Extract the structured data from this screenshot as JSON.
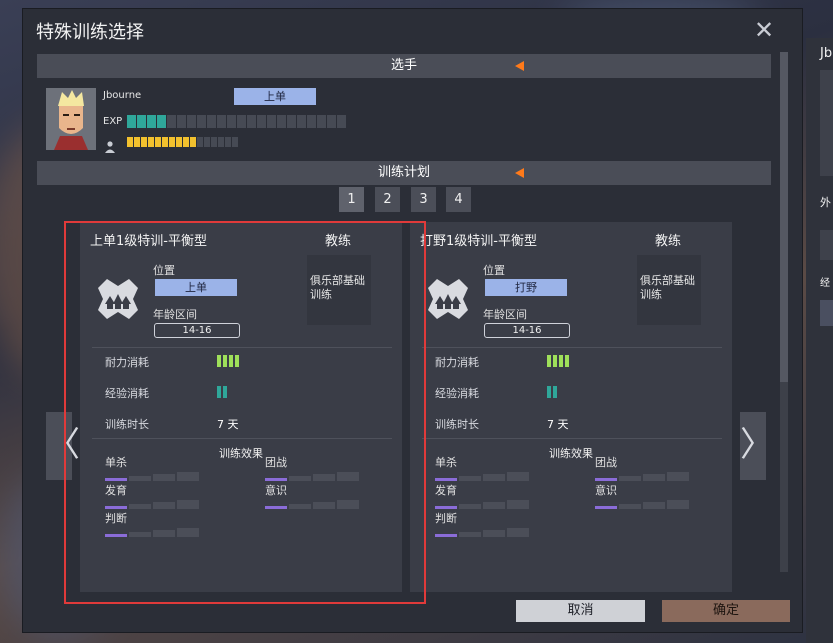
{
  "dialog": {
    "title": "特殊训练选择",
    "close_glyph": "✕"
  },
  "player_section": {
    "header": "选手",
    "name": "Jbourne",
    "position": "上单",
    "exp_label": "EXP",
    "exp_filled": 4,
    "exp_total": 22,
    "stamina_filled": 10,
    "stamina_total": 16
  },
  "plan_section": {
    "header": "训练计划",
    "pages": [
      "1",
      "2",
      "3",
      "4"
    ],
    "active_page": 0
  },
  "cards": [
    {
      "title": "上单1级特训-平衡型",
      "coach_label": "教练",
      "coach_text": "俱乐部基础训练",
      "position_label": "位置",
      "position": "上单",
      "age_label": "年龄区间",
      "age_range": "14-16",
      "stamina_label": "耐力消耗",
      "stamina_pips": 4,
      "exp_label": "经验消耗",
      "exp_pips": 2,
      "duration_label": "训练时长",
      "duration": "7 天",
      "effects_title": "训练效果",
      "effects": [
        {
          "label": "单杀",
          "level": 1
        },
        {
          "label": "团战",
          "level": 1
        },
        {
          "label": "发育",
          "level": 1
        },
        {
          "label": "意识",
          "level": 1
        },
        {
          "label": "判断",
          "level": 1
        }
      ]
    },
    {
      "title": "打野1级特训-平衡型",
      "coach_label": "教练",
      "coach_text": "俱乐部基础训练",
      "position_label": "位置",
      "position": "打野",
      "age_label": "年龄区间",
      "age_range": "14-16",
      "stamina_label": "耐力消耗",
      "stamina_pips": 4,
      "exp_label": "经验消耗",
      "exp_pips": 2,
      "duration_label": "训练时长",
      "duration": "7 天",
      "effects_title": "训练效果",
      "effects": [
        {
          "label": "单杀",
          "level": 1
        },
        {
          "label": "团战",
          "level": 1
        },
        {
          "label": "发育",
          "level": 1
        },
        {
          "label": "意识",
          "level": 1
        },
        {
          "label": "判断",
          "level": 1
        }
      ]
    }
  ],
  "buttons": {
    "cancel": "取消",
    "confirm": "确定",
    "prev": "〈",
    "next": "〉"
  },
  "side_panel": {
    "title": "Jb",
    "label_a": "外",
    "label_b": "经"
  },
  "icons": [
    "close-icon",
    "orange-arrow-icon",
    "person-icon",
    "team-emblem-icon",
    "chevron-left-icon",
    "chevron-right-icon"
  ],
  "colors": {
    "accent_orange": "#ff7a1a",
    "position_blue": "#9bb3e8",
    "exp_teal": "#2fa79a",
    "stamina_yellow": "#f2c12e",
    "pip_green": "#9fe05a",
    "effect_purple": "#8a6cd8",
    "highlight_red": "#e03a3a"
  }
}
